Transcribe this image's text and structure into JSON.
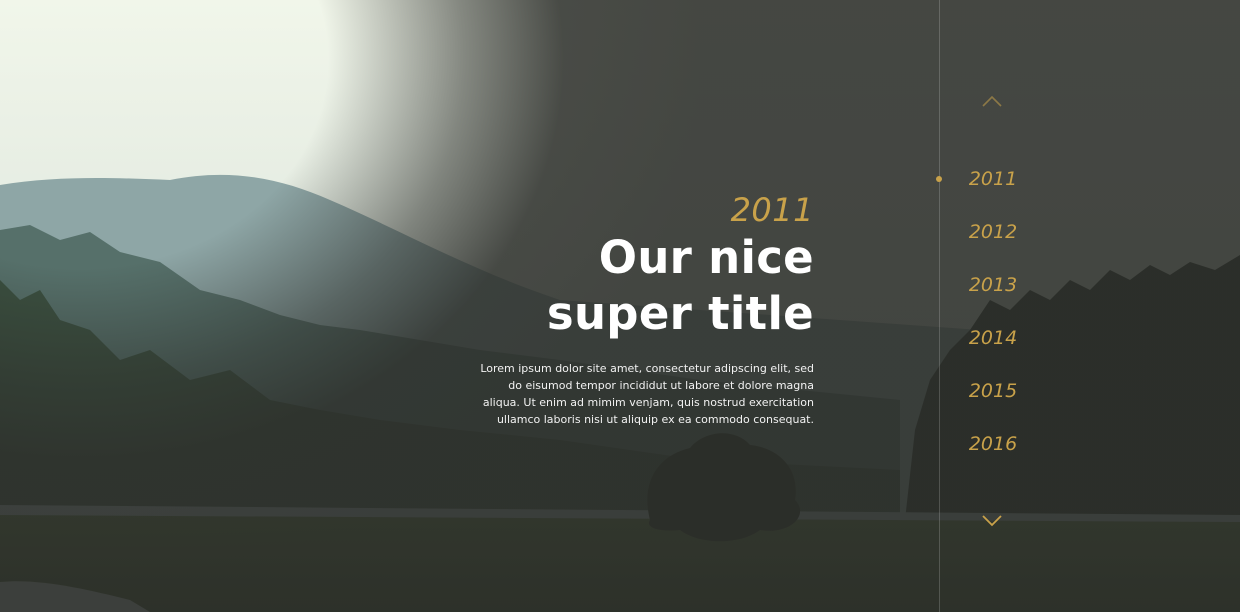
{
  "hero": {
    "year": "2011",
    "title_line1": "Our nice",
    "title_line2": "super title",
    "body_line1": "Lorem ipsum dolor site amet, consectetur adipscing elit, sed",
    "body_line2": "do eisumod tempor incididut ut labore et dolore magna",
    "body_line3": "aliqua. Ut enim ad mimim venjam, quis nostrud exercitation",
    "body_line4": "ullamco laboris nisi ut aliquip ex ea commodo consequat."
  },
  "timeline": {
    "years": [
      "2011",
      "2012",
      "2013",
      "2014",
      "2015",
      "2016"
    ],
    "active": "2011",
    "prev_icon": "chevron-up-icon",
    "next_icon": "chevron-down-icon"
  },
  "colors": {
    "accent": "#c9a24a",
    "overlay": "#2d2f2b",
    "text": "#ffffff"
  }
}
